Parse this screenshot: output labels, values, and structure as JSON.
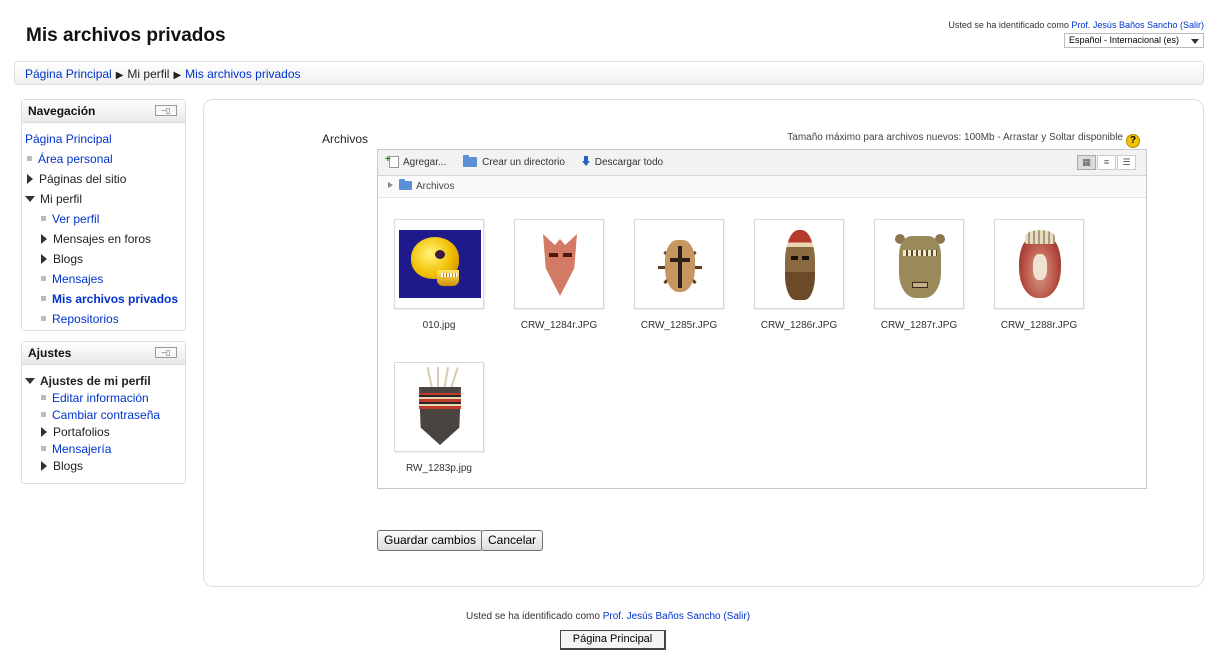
{
  "header": {
    "title": "Mis archivos privados",
    "login_prefix": "Usted se ha identificado como",
    "user_name": "Prof. Jesús Baños Sancho",
    "logout_label": "(Salir)",
    "language": "Español - Internacional (es)"
  },
  "breadcrumb": {
    "items": [
      "Página Principal",
      "Mi perfil",
      "Mis archivos privados"
    ]
  },
  "navigation": {
    "title": "Navegación",
    "items": [
      {
        "label": "Página Principal"
      },
      {
        "label": "Área personal"
      },
      {
        "label": "Páginas del sitio"
      },
      {
        "label": "Mi perfil"
      },
      {
        "label": "Ver perfil"
      },
      {
        "label": "Mensajes en foros"
      },
      {
        "label": "Blogs"
      },
      {
        "label": "Mensajes"
      },
      {
        "label": "Mis archivos privados"
      },
      {
        "label": "Repositorios"
      }
    ]
  },
  "settings": {
    "title": "Ajustes",
    "items": [
      {
        "label": "Ajustes de mi perfil"
      },
      {
        "label": "Editar información"
      },
      {
        "label": "Cambiar contraseña"
      },
      {
        "label": "Portafolios"
      },
      {
        "label": "Mensajería"
      },
      {
        "label": "Blogs"
      }
    ]
  },
  "files": {
    "label": "Archivos",
    "max_size_text": "Tamaño máximo para archivos nuevos: 100Mb - Arrastar y Soltar disponible",
    "toolbar": {
      "add": "Agregar...",
      "create_dir": "Crear un directorio",
      "download_all": "Descargar todo"
    },
    "path": "Archivos",
    "items": [
      {
        "name": "010.jpg",
        "icon": "skull-image"
      },
      {
        "name": "CRW_1284r.JPG",
        "icon": "mask-image"
      },
      {
        "name": "CRW_1285r.JPG",
        "icon": "mask-image"
      },
      {
        "name": "CRW_1286r.JPG",
        "icon": "mask-image"
      },
      {
        "name": "CRW_1287r.JPG",
        "icon": "mask-image"
      },
      {
        "name": "CRW_1288r.JPG",
        "icon": "mask-image"
      },
      {
        "name": "RW_1283p.jpg",
        "icon": "mask-image"
      }
    ]
  },
  "actions": {
    "save": "Guardar cambios",
    "cancel": "Cancelar"
  },
  "footer": {
    "login_prefix": "Usted se ha identificado como",
    "user_name": "Prof. Jesús Baños Sancho",
    "logout_label": "(Salir)",
    "home_button": "Página Principal"
  },
  "colors": {
    "link": "#0033cc",
    "help_icon": "#f3c300"
  }
}
